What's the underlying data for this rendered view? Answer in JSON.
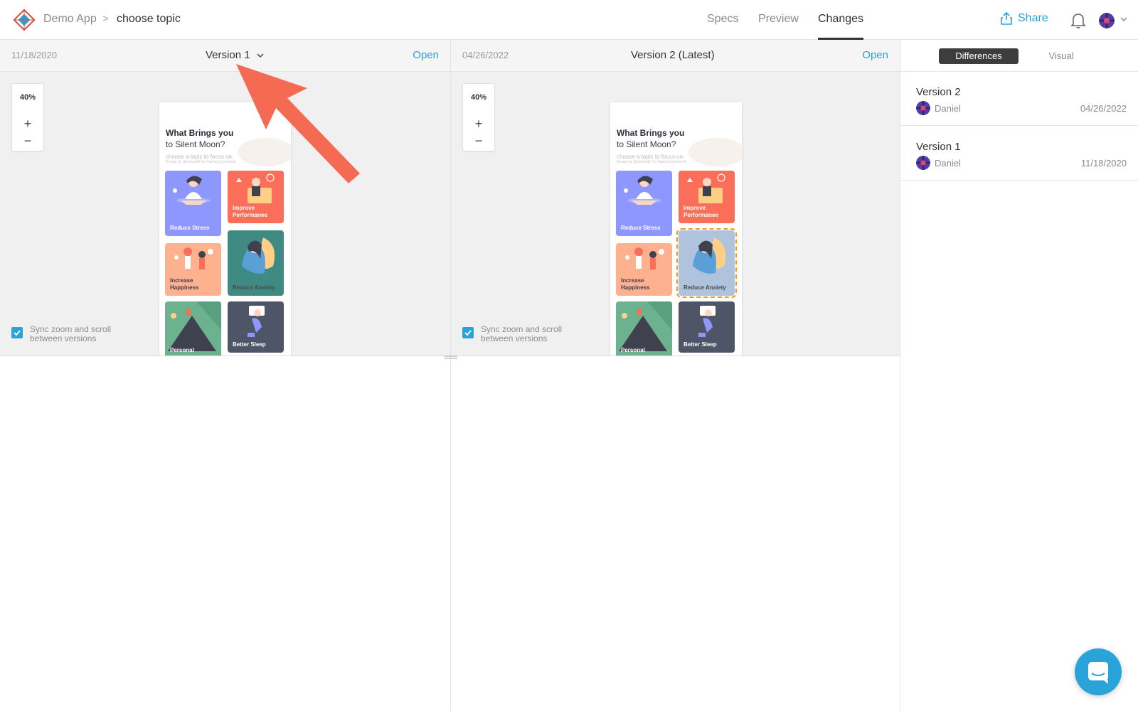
{
  "header": {
    "app_name": "Demo App",
    "breadcrumb_separator": ">",
    "page_name": "choose topic",
    "tabs": [
      "Specs",
      "Preview",
      "Changes"
    ],
    "active_tab": "Changes",
    "share_label": "Share"
  },
  "left_pane": {
    "date": "11/18/2020",
    "version_label": "Version 1",
    "open_label": "Open",
    "zoom": "40%",
    "zoom_in": "+",
    "zoom_out": "−",
    "sync_label": "Sync zoom and scroll between versions"
  },
  "right_pane": {
    "date": "04/26/2022",
    "version_label": "Version 2 (Latest)",
    "open_label": "Open",
    "zoom": "40%",
    "zoom_in": "+",
    "zoom_out": "−",
    "sync_label": "Sync zoom and scroll between versions"
  },
  "design": {
    "title": "What Brings you",
    "subtitle": "to Silent Moon?",
    "hint": "choose a topic to focus on:",
    "credit": "Design by @elehoe87 for Figma Community",
    "cards": [
      {
        "label": "Reduce Stress",
        "color": "#8e97fd"
      },
      {
        "label": "Improve Performanee",
        "color": "#fa6e5a"
      },
      {
        "label": "Increase Happiness",
        "color": "#feb18f"
      },
      {
        "label": "Reduce Anxiety",
        "color": "#3f8b84"
      },
      {
        "label": "Personal",
        "color": "#6cb28e"
      },
      {
        "label": "Better Sleep",
        "color": "#4e5567"
      }
    ],
    "changed_card_color": "#afc3dd"
  },
  "sidebar": {
    "segments": [
      "Differences",
      "Visual"
    ],
    "versions": [
      {
        "name": "Version 2",
        "user": "Daniel",
        "date": "04/26/2022"
      },
      {
        "name": "Version 1",
        "user": "Daniel",
        "date": "11/18/2020"
      }
    ]
  },
  "colors": {
    "accent": "#25a3db",
    "annotation_arrow": "#f56a52",
    "change_highlight": "#f39a1d"
  }
}
